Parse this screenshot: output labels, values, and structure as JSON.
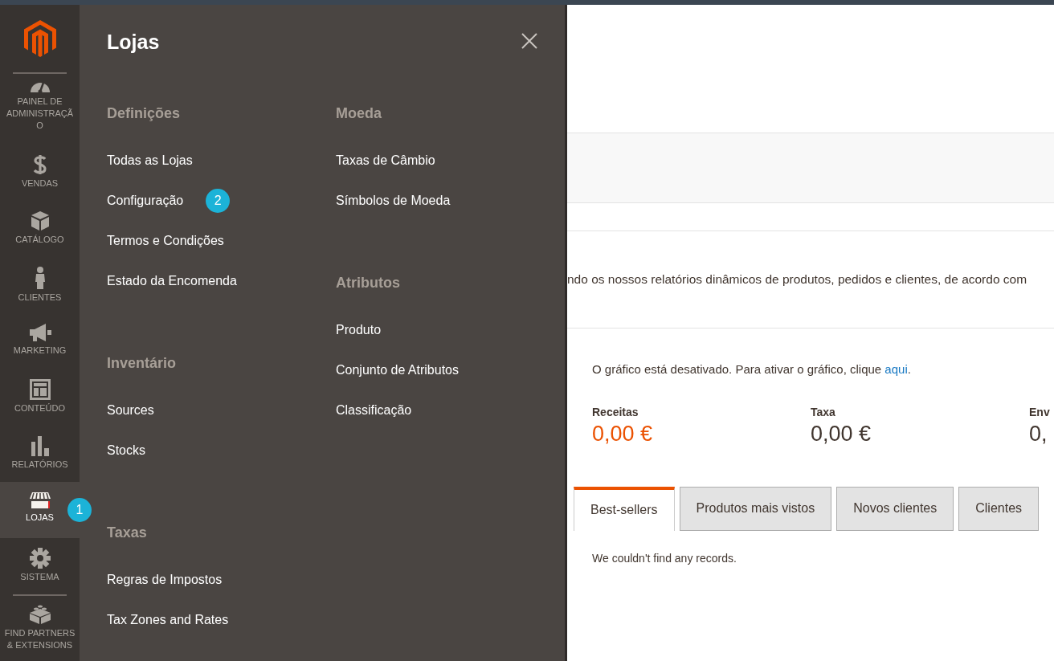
{
  "sidebar": {
    "items": [
      {
        "label": "PAINEL DE ADMINISTRAÇÃ O",
        "selected": false
      },
      {
        "label": "VENDAS",
        "selected": false
      },
      {
        "label": "CATÁLOGO",
        "selected": false
      },
      {
        "label": "CLIENTES",
        "selected": false
      },
      {
        "label": "MARKETING",
        "selected": false
      },
      {
        "label": "CONTEÚDO",
        "selected": false
      },
      {
        "label": "RELATÓRIOS",
        "selected": false
      },
      {
        "label": "LOJAS",
        "selected": true,
        "marker": "1"
      },
      {
        "label": "SISTEMA",
        "selected": false
      },
      {
        "label": "FIND PARTNERS & EXTENSIONS",
        "selected": false
      }
    ]
  },
  "flyout": {
    "title": "Lojas",
    "columns": [
      {
        "sections": [
          {
            "heading": "Definições",
            "items": [
              {
                "label": "Todas as Lojas"
              },
              {
                "label": "Configuração",
                "marker": "2"
              },
              {
                "label": "Termos e Condições"
              },
              {
                "label": "Estado da Encomenda"
              }
            ]
          },
          {
            "heading": "Inventário",
            "items": [
              {
                "label": "Sources"
              },
              {
                "label": "Stocks"
              }
            ]
          },
          {
            "heading": "Taxas",
            "items": [
              {
                "label": "Regras de Impostos"
              },
              {
                "label": "Tax Zones and Rates"
              }
            ]
          }
        ]
      },
      {
        "sections": [
          {
            "heading": "Moeda",
            "items": [
              {
                "label": "Taxas de Câmbio"
              },
              {
                "label": "Símbolos de Moeda"
              }
            ]
          },
          {
            "heading": "Atributos",
            "items": [
              {
                "label": "Produto"
              },
              {
                "label": "Conjunto de Atributos"
              },
              {
                "label": "Classificação"
              }
            ]
          }
        ]
      }
    ]
  },
  "content": {
    "intro": "ndo os nossos relatórios dinâmicos de produtos, pedidos e clientes, de acordo com",
    "chart_message": "O gráfico está desativado. Para ativar o gráfico, clique",
    "chart_link": "aqui",
    "chart_end": ".",
    "stats": [
      {
        "label": "Receitas",
        "value": "0,00 €",
        "highlight": true
      },
      {
        "label": "Taxa",
        "value": "0,00 €",
        "highlight": false
      },
      {
        "label": "Env",
        "value": "0,",
        "highlight": false
      }
    ],
    "tabs": [
      {
        "label": "Best-sellers",
        "selected": true
      },
      {
        "label": "Produtos mais vistos",
        "selected": false
      },
      {
        "label": "Novos clientes",
        "selected": false
      },
      {
        "label": "Clientes",
        "selected": false
      }
    ],
    "empty_message": "We couldn't find any records."
  }
}
